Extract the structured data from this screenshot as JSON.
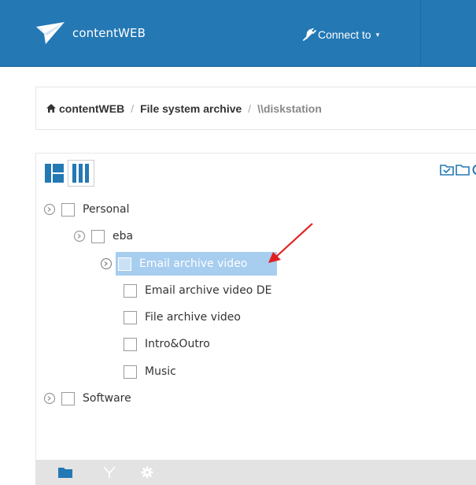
{
  "app": {
    "brand": "contentWEB",
    "connect_label": "Connect to",
    "caret": "▾"
  },
  "breadcrumb": {
    "home": "contentWEB",
    "sep1": "/",
    "item1": "File system archive",
    "sep2": "/",
    "item2": "\\\\diskstation"
  },
  "tree": {
    "nodes": [
      {
        "label": "Personal"
      },
      {
        "label": "eba"
      },
      {
        "label": "Email archive video"
      },
      {
        "label": "Email archive video DE"
      },
      {
        "label": "File archive video"
      },
      {
        "label": "Intro&Outro"
      },
      {
        "label": "Music"
      },
      {
        "label": "Software"
      }
    ],
    "selected": "Email archive video"
  },
  "colors": {
    "navbar": "#2478b4",
    "selection": "#a7cdef",
    "accent": "#2478b4",
    "arrow": "#e02020"
  },
  "icons": {
    "view_split": "split-view-icon",
    "view_columns": "columns-view-icon",
    "toolbar": [
      "check-folder-icon",
      "folder-icon",
      "refresh-icon"
    ],
    "bottom": [
      "folder-icon",
      "filter-icon",
      "gear-icon"
    ]
  }
}
